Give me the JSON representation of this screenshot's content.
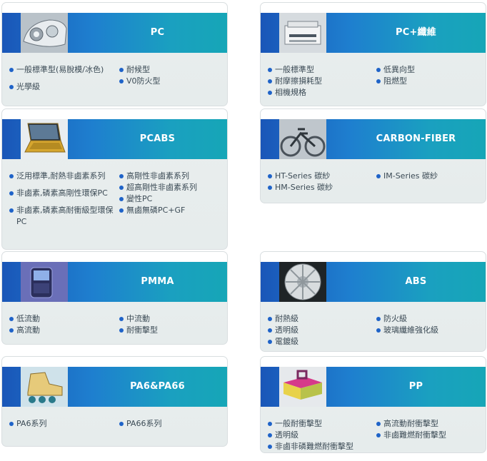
{
  "cards": [
    {
      "title": "PC",
      "col1": [
        "一般標準型(易脫模/冰色)",
        "光學級"
      ],
      "col2": [
        "耐候型",
        "V0防火型"
      ]
    },
    {
      "title": "PC+纖維",
      "col1": [
        "一般標準型",
        "耐摩擦損耗型",
        "相機規格"
      ],
      "col2": [
        "低異向型",
        "阻燃型"
      ]
    },
    {
      "title": "PCABS",
      "col1": [
        "泛用標準,耐熱非鹵素系列",
        "非鹵素,磷素高剛性環保PC",
        "非鹵素,磷素高耐衝級型環保PC"
      ],
      "col2": [
        "高剛性非鹵素系列",
        "超高剛性非鹵素系列",
        "變性PC",
        "無鹵無磷PC+GF"
      ]
    },
    {
      "title": "CARBON-FIBER",
      "col1": [
        "HT-Series 碳紗",
        "HM-Series 碳紗"
      ],
      "col2": [
        "IM-Series 碳紗"
      ]
    },
    {
      "title": "PMMA",
      "col1": [
        "低流動",
        "高流動"
      ],
      "col2": [
        "中流動",
        "耐衝擊型"
      ]
    },
    {
      "title": "ABS",
      "col1": [
        "耐熱級",
        "透明級",
        "電鍍級"
      ],
      "col2": [
        "防火級",
        "玻璃纖維強化級"
      ]
    },
    {
      "title": "PA6&PA66",
      "col1": [
        "PA6系列"
      ],
      "col2": [
        "PA66系列"
      ]
    },
    {
      "title": "PP",
      "col1": [
        "一般耐衝擊型",
        "透明級",
        "非鹵非磷難燃耐衝擊型"
      ],
      "col2": [
        "高流動耐衝擊型",
        "非鹵難燃耐衝擊型"
      ]
    }
  ]
}
